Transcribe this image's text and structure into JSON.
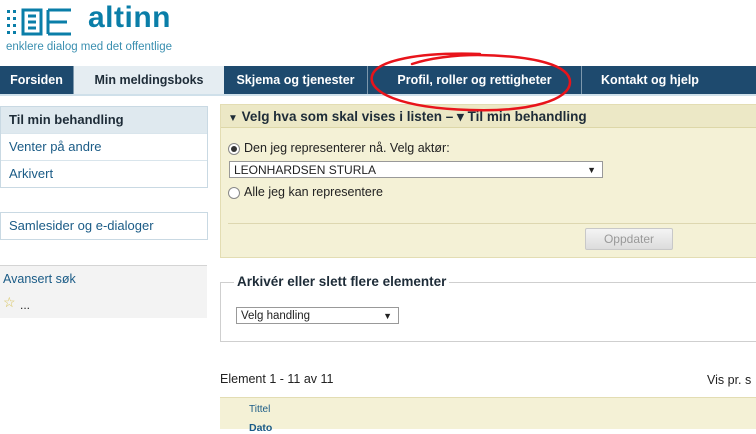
{
  "brand": {
    "name": "altinn",
    "tagline": "enklere dialog med det offentlige",
    "color": "#0a7ea8"
  },
  "nav": {
    "tabs": [
      {
        "label": "Forsiden",
        "active": false
      },
      {
        "label": "Min meldingsboks",
        "active": true
      },
      {
        "label": "Skjema og tjenester",
        "active": false
      },
      {
        "label": "Profil, roller og rettigheter",
        "active": false
      },
      {
        "label": "Kontakt og hjelp",
        "active": false
      }
    ],
    "background": "#1e4a6e"
  },
  "sidebar": {
    "main_items": [
      {
        "label": "Til min behandling",
        "active": true
      },
      {
        "label": "Venter på andre",
        "active": false
      },
      {
        "label": "Arkivert",
        "active": false
      }
    ],
    "secondary_item": "Samlesider og e-dialoger",
    "advanced_search": "Avansert søk",
    "favorites_more": "..."
  },
  "filter": {
    "title": "Velg hva som skal vises i listen – ▾ Til min behandling",
    "option_represent": "Den jeg representerer nå. Velg aktør:",
    "selected_actor": "LEONHARDSEN STURLA",
    "option_all": "Alle jeg kan representere",
    "update_button": "Oppdater"
  },
  "archive": {
    "legend": "Arkivér eller slett flere elementer",
    "action_select": "Velg handling"
  },
  "list": {
    "count_text": "Element 1 - 11 av 11",
    "per_page_text": "Vis pr. s",
    "col_title": "Tittel",
    "col_date": "Dato"
  },
  "annotation": {
    "color": "#e8141b"
  }
}
